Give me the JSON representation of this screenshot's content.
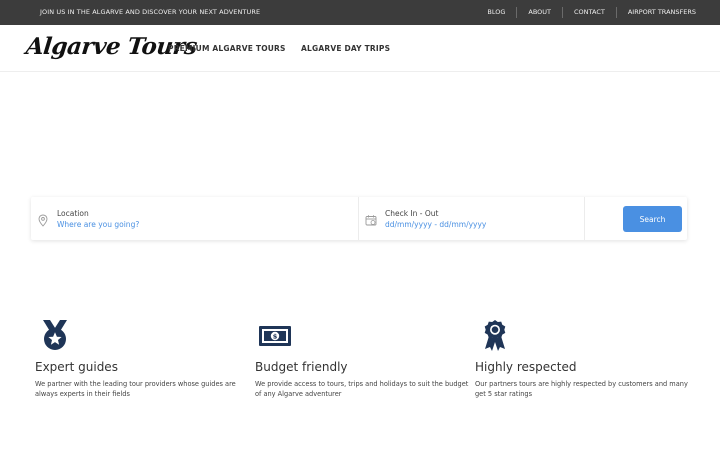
{
  "topbar": {
    "tagline": "JOIN US IN THE ALGARVE AND DISCOVER YOUR NEXT ADVENTURE",
    "links": [
      "BLOG",
      "ABOUT",
      "CONTACT",
      "AIRPORT TRANSFERS"
    ]
  },
  "header": {
    "logo": "Algarve Tours",
    "nav": [
      "PREMIUM ALGARVE TOURS",
      "ALGARVE DAY TRIPS"
    ]
  },
  "search": {
    "location_label": "Location",
    "location_placeholder": "Where are you going?",
    "dates_label": "Check In - Out",
    "dates_placeholder": "dd/mm/yyyy - dd/mm/yyyy",
    "button_label": "Search",
    "location_icon": "map-pin-icon",
    "dates_icon": "calendar-icon"
  },
  "features": [
    {
      "icon": "medal-star-icon",
      "title": "Expert guides",
      "text": "We partner with the leading tour providers whose guides are always experts in their fields"
    },
    {
      "icon": "banknote-icon",
      "title": "Budget friendly",
      "text": "We provide access to tours, trips and holidays to suit the budget of any Algarve adventurer"
    },
    {
      "icon": "award-ribbon-icon",
      "title": "Highly respected",
      "text": "Our partners tours are highly respected by customers and many get 5 star ratings"
    }
  ],
  "colors": {
    "topbar_bg": "#3c3c3c",
    "accent": "#4a90e2",
    "icon_navy": "#1f3557"
  }
}
